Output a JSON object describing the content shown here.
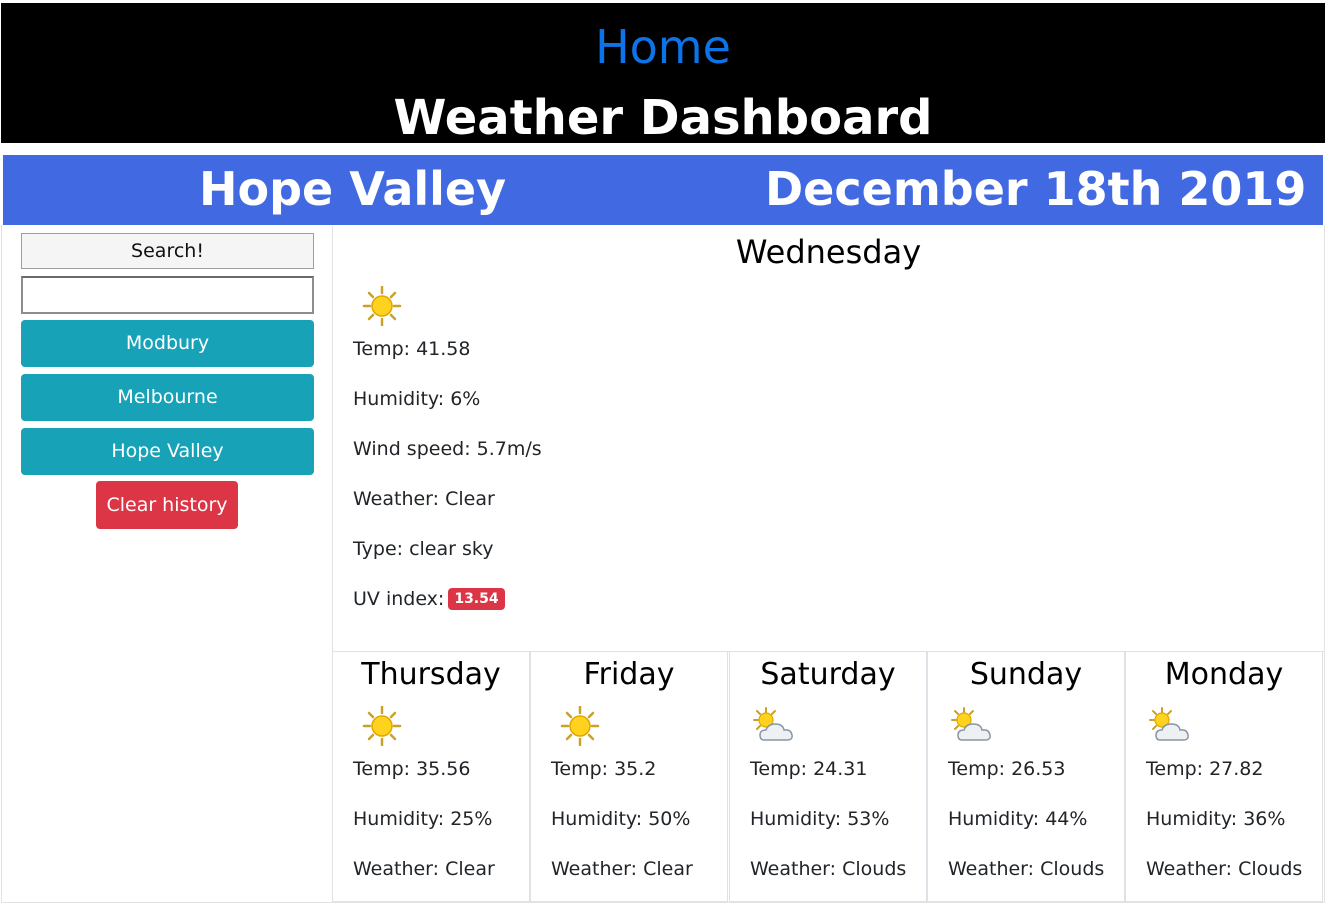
{
  "header": {
    "home_label": "Home",
    "title": "Weather Dashboard"
  },
  "banner": {
    "city": "Hope Valley",
    "date": "December 18th 2019"
  },
  "sidebar": {
    "search_button": "Search!",
    "search_value": "",
    "history": [
      {
        "label": "Modbury"
      },
      {
        "label": "Melbourne"
      },
      {
        "label": "Hope Valley"
      }
    ],
    "clear_button": "Clear history"
  },
  "current": {
    "day": "Wednesday",
    "icon": "sun-icon",
    "temp": "Temp: 41.58",
    "humidity": "Humidity: 6%",
    "wind": "Wind speed: 5.7m/s",
    "weather": "Weather: Clear",
    "type": "Type: clear sky",
    "uv_label": "UV index:",
    "uv_value": "13.54",
    "uv_color": "#dc3545"
  },
  "forecast": [
    {
      "day": "Thursday",
      "icon": "sun-icon",
      "temp": "Temp: 35.56",
      "humidity": "Humidity: 25%",
      "weather": "Weather: Clear"
    },
    {
      "day": "Friday",
      "icon": "sun-icon",
      "temp": "Temp: 35.2",
      "humidity": "Humidity: 50%",
      "weather": "Weather: Clear"
    },
    {
      "day": "Saturday",
      "icon": "sun-cloud-icon",
      "temp": "Temp: 24.31",
      "humidity": "Humidity: 53%",
      "weather": "Weather: Clouds"
    },
    {
      "day": "Sunday",
      "icon": "sun-cloud-icon",
      "temp": "Temp: 26.53",
      "humidity": "Humidity: 44%",
      "weather": "Weather: Clouds"
    },
    {
      "day": "Monday",
      "icon": "sun-cloud-icon",
      "temp": "Temp: 27.82",
      "humidity": "Humidity: 36%",
      "weather": "Weather: Clouds"
    }
  ],
  "colors": {
    "banner": "#4169e1",
    "home_link": "#0d74e8",
    "city_button": "#17a2b8",
    "clear_button": "#dc3545"
  }
}
